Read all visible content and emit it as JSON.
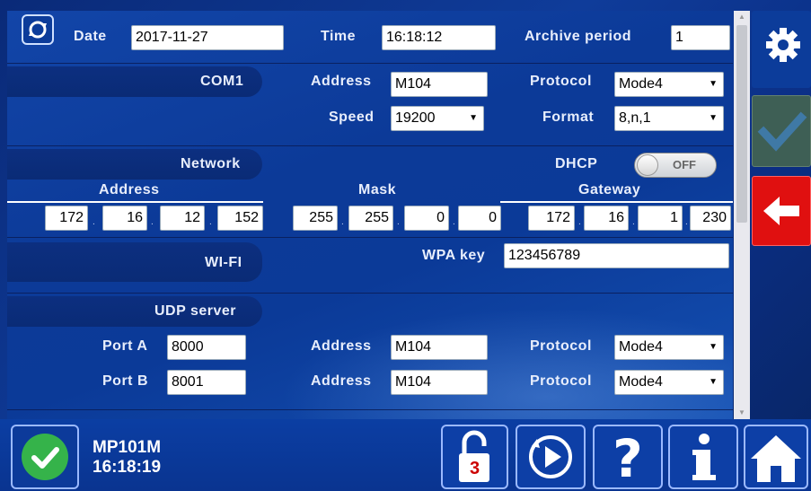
{
  "header": {
    "date_label": "Date",
    "date_value": "2017-11-27",
    "time_label": "Time",
    "time_value": "16:18:12",
    "archive_label": "Archive period",
    "archive_value": "1"
  },
  "com1": {
    "title": "COM1",
    "address_label": "Address",
    "address_value": "M104",
    "protocol_label": "Protocol",
    "protocol_value": "Mode4",
    "speed_label": "Speed",
    "speed_value": "19200",
    "format_label": "Format",
    "format_value": "8,n,1"
  },
  "network": {
    "title": "Network",
    "dhcp_label": "DHCP",
    "dhcp_state": "OFF",
    "address_label": "Address",
    "address": [
      "172",
      "16",
      "12",
      "152"
    ],
    "mask_label": "Mask",
    "mask": [
      "255",
      "255",
      "0",
      "0"
    ],
    "gateway_label": "Gateway",
    "gateway": [
      "172",
      "16",
      "1",
      "230"
    ]
  },
  "wifi": {
    "title": "WI-FI",
    "wpa_label": "WPA key",
    "wpa_value": "123456789"
  },
  "udp": {
    "title": "UDP server",
    "port_a_label": "Port A",
    "port_a_value": "8000",
    "port_b_label": "Port B",
    "port_b_value": "8001",
    "address_label": "Address",
    "address_a_value": "M104",
    "address_b_value": "M104",
    "protocol_label": "Protocol",
    "protocol_a_value": "Mode4",
    "protocol_b_value": "Mode4"
  },
  "footer": {
    "device_name": "MP101M",
    "device_time": "16:18:19",
    "lock_badge": "3"
  },
  "icons": {
    "refresh": "refresh-icon",
    "settings": "gear-icon",
    "confirm": "checkmark-icon",
    "back": "arrow-left-icon",
    "status": "checkmark-circle-icon",
    "lock": "unlock-icon",
    "play": "play-icon",
    "help": "question-icon",
    "info": "info-icon",
    "home": "home-icon"
  },
  "colors": {
    "background": "#0b3a98",
    "back_button": "#e01010",
    "confirm_disabled": "#3e5f55",
    "status_ok": "#35b34a"
  }
}
